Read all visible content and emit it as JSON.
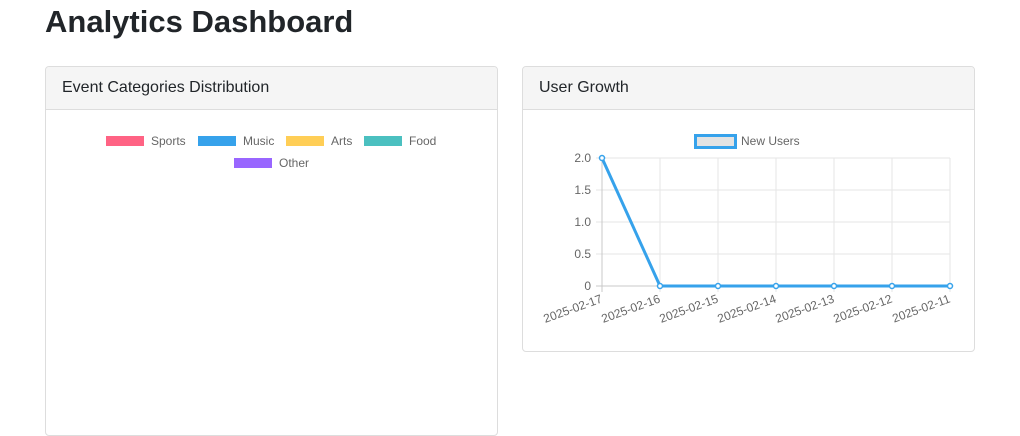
{
  "page": {
    "title": "Analytics Dashboard"
  },
  "cards": {
    "categories": {
      "title": "Event Categories Distribution",
      "legend": [
        {
          "label": "Sports",
          "color": "#ff6384"
        },
        {
          "label": "Music",
          "color": "#36a2eb"
        },
        {
          "label": "Arts",
          "color": "#ffce56"
        },
        {
          "label": "Food",
          "color": "#4bc0c0"
        },
        {
          "label": "Other",
          "color": "#9966ff"
        }
      ]
    },
    "growth": {
      "title": "User Growth"
    }
  },
  "chart_data": {
    "type": "line",
    "x": [
      "2025-02-17",
      "2025-02-16",
      "2025-02-15",
      "2025-02-14",
      "2025-02-13",
      "2025-02-12",
      "2025-02-11"
    ],
    "series": [
      {
        "name": "New Users",
        "values": [
          2,
          0,
          0,
          0,
          0,
          0,
          0
        ],
        "color": "#36a2eb"
      }
    ],
    "ylim": [
      0,
      2
    ],
    "yticks": [
      "2.0",
      "1.5",
      "1.0",
      "0.5",
      "0"
    ],
    "grid": true,
    "legend": "top"
  }
}
